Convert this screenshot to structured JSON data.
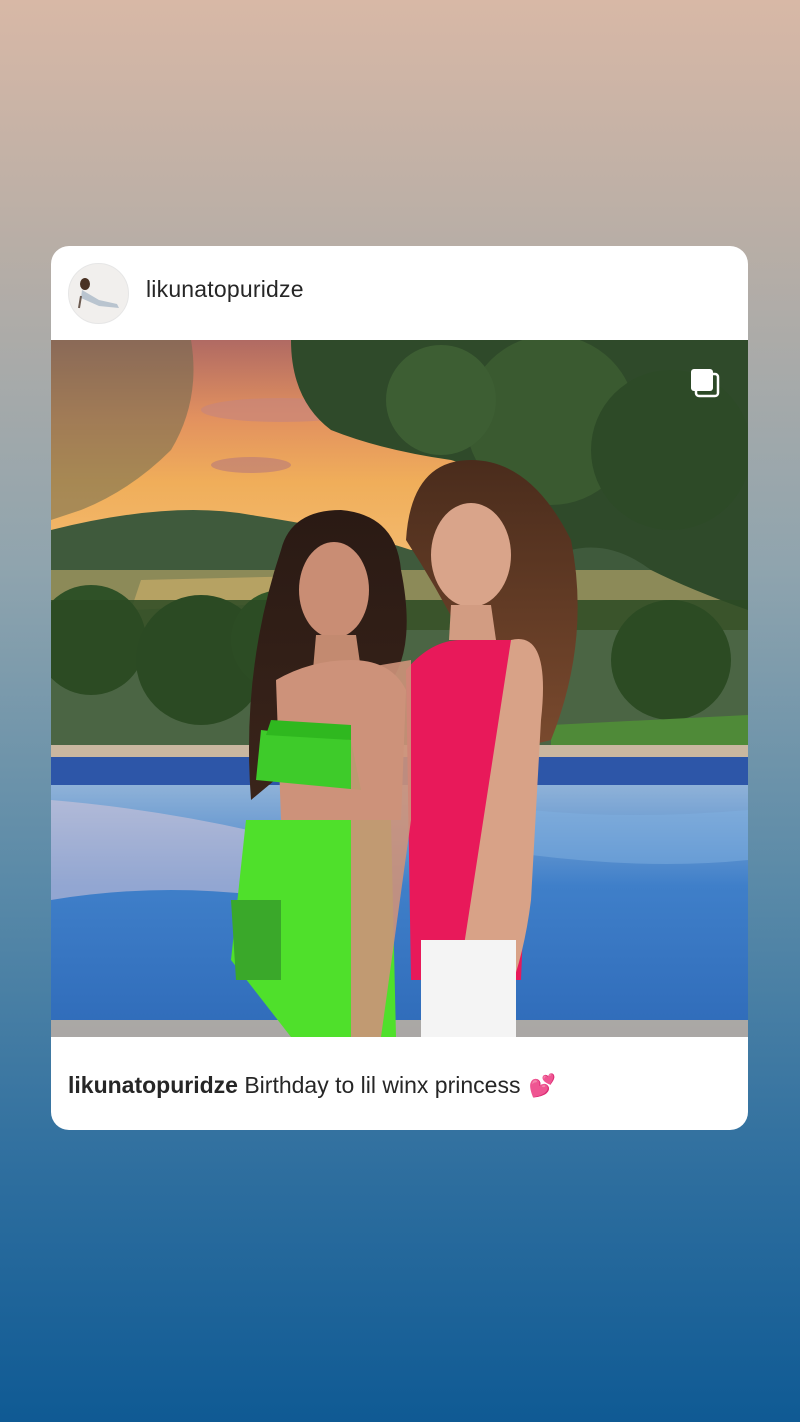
{
  "post": {
    "username": "likunatopuridze",
    "caption_user": "likunatopuridze",
    "caption_text": " Birthday to lil winx princess ",
    "caption_emoji": "💕"
  },
  "icons": {
    "avatar": "profile-avatar",
    "carousel": "multiple-photos-icon"
  },
  "colors": {
    "card_background": "#ffffff",
    "text": "#262626"
  }
}
